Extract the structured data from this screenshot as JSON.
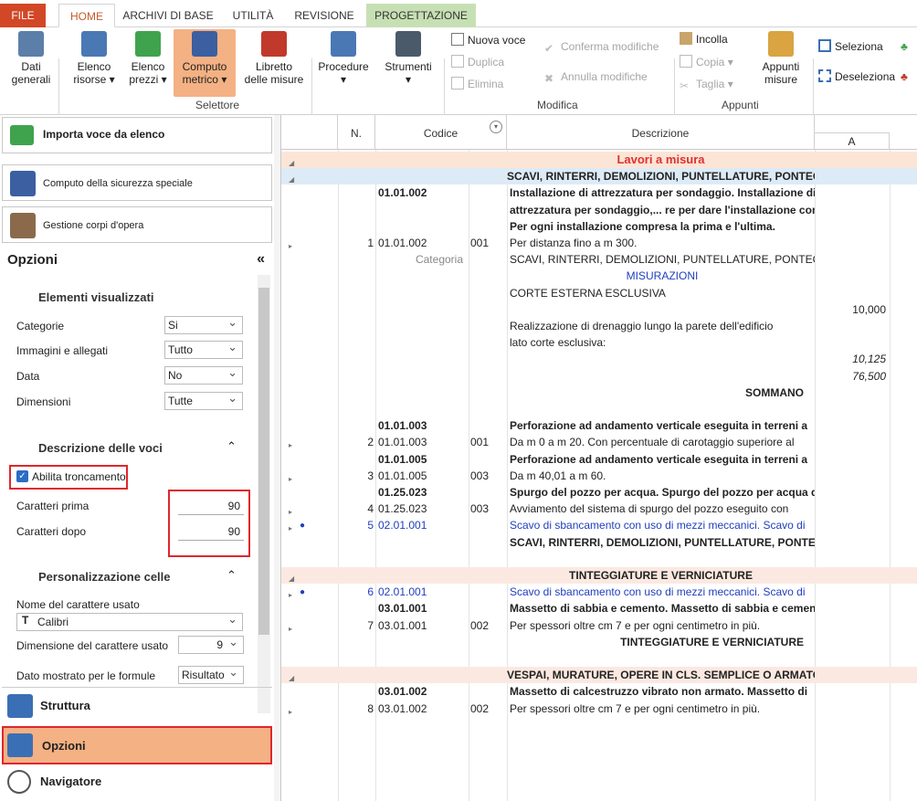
{
  "tabs": [
    "FILE",
    "HOME",
    "ARCHIVI DI BASE",
    "UTILITÀ",
    "REVISIONE",
    "PROGETTAZIONE"
  ],
  "ribbon": {
    "big": [
      {
        "label1": "Dati",
        "label2": "generali"
      },
      {
        "label1": "Elenco",
        "label2": "risorse ▾"
      },
      {
        "label1": "Elenco",
        "label2": "prezzi ▾"
      },
      {
        "label1": "Computo",
        "label2": "metrico ▾"
      },
      {
        "label1": "Libretto",
        "label2": "delle misure"
      },
      {
        "label1": "Procedure",
        "label2": "▾"
      },
      {
        "label1": "Strumenti",
        "label2": "▾"
      },
      {
        "label1": "Appunti",
        "label2": "misure"
      }
    ],
    "small": {
      "nuova": "Nuova voce",
      "duplica": "Duplica",
      "elimina": "Elimina",
      "conferma": "Conferma modifiche",
      "annulla": "Annulla modifiche",
      "incolla": "Incolla",
      "copia": "Copia",
      "taglia": "Taglia",
      "seleziona": "Seleziona",
      "deseleziona": "Deseleziona"
    },
    "groups": {
      "selettore": "Selettore",
      "modifica": "Modifica",
      "appunti": "Appunti"
    }
  },
  "left": {
    "importa": "Importa voce da elenco",
    "sicurezza": "Computo della sicurezza speciale",
    "corpi": "Gestione corpi d'opera",
    "opzioni_title": "Opzioni",
    "collapse": "«",
    "sec1": "Elementi visualizzati",
    "categorie_lbl": "Categorie",
    "categorie_val": "Si",
    "immagini_lbl": "Immagini e allegati",
    "immagini_val": "Tutto",
    "data_lbl": "Data",
    "data_val": "No",
    "dimensioni_lbl": "Dimensioni",
    "dimensioni_val": "Tutte",
    "sec2": "Descrizione delle voci",
    "abilita": "Abilita troncamento",
    "prima_lbl": "Caratteri prima",
    "prima_val": "90",
    "dopo_lbl": "Caratteri dopo",
    "dopo_val": "90",
    "sec3": "Personalizzazione celle",
    "font_lbl": "Nome del carattere usato",
    "font_val": "Calibri",
    "size_lbl": "Dimensione del carattere usato",
    "size_val": "9",
    "formule_lbl": "Dato mostrato per le formule",
    "formule_val": "Risultato",
    "nav": [
      "Struttura",
      "Opzioni",
      "Navigatore"
    ]
  },
  "grid": {
    "headers": {
      "n": "N.",
      "codice": "Codice",
      "descrizione": "Descrizione",
      "a": "A"
    },
    "rows": [
      {
        "type": "section",
        "desc": "Lavori a misura",
        "bg": "#fbe5d6",
        "color": "#e03030",
        "tri": true
      },
      {
        "type": "cat",
        "desc": "SCAVI, RINTERRI, DEMOLIZIONI, PUNTELLATURE, PONTEGGI",
        "bg": "#ddebf7",
        "tri": true
      },
      {
        "cod": "01.01.002",
        "desc": "Installazione di attrezzatura per sondaggio. Installazione di",
        "bold": true
      },
      {
        "desc": "attrezzatura per sondaggio,... re per dare l'installazione completa.",
        "bold": true
      },
      {
        "desc": "Per ogni installazione compresa la prima e l'ultima.",
        "bold": true
      },
      {
        "n": "1",
        "cod": "01.01.002",
        "sub": "001",
        "desc": "Per distanza fino a m 300.",
        "tri": true
      },
      {
        "cod": "Categoria",
        "desc": "SCAVI, RINTERRI, DEMOLIZIONI, PUNTELLATURE, PONTEGGI",
        "codgray": true
      },
      {
        "desc": "MISURAZIONI",
        "blue": true,
        "center": true
      },
      {
        "desc": "CORTE ESTERNA ESCLUSIVA"
      },
      {
        "a": "10,000"
      },
      {
        "desc": "Realizzazione di drenaggio lungo la parete dell'edificio"
      },
      {
        "desc": "lato corte esclusiva:"
      },
      {
        "a": "10,125",
        "italic": true
      },
      {
        "a": "76,500",
        "italic": true
      },
      {
        "desc": "SOMMANO",
        "bold": true,
        "right": true
      },
      {},
      {
        "cod": "01.01.003",
        "desc": "Perforazione ad andamento verticale eseguita in terreni a",
        "bold": true
      },
      {
        "n": "2",
        "cod": "01.01.003",
        "sub": "001",
        "desc": "Da m 0 a m 20. Con percentuale di carotaggio superiore al",
        "tri": true
      },
      {
        "cod": "01.01.005",
        "desc": "Perforazione ad andamento verticale eseguita in terreni a",
        "bold": true
      },
      {
        "n": "3",
        "cod": "01.01.005",
        "sub": "003",
        "desc": "Da m 40,01 a m 60.",
        "tri": true
      },
      {
        "cod": "01.25.023",
        "desc": "Spurgo del pozzo per acqua. Spurgo del pozzo per acqua da",
        "bold": true
      },
      {
        "n": "4",
        "cod": "01.25.023",
        "sub": "003",
        "desc": "Avviamento del sistema di spurgo del pozzo eseguito con",
        "tri": true
      },
      {
        "n": "5",
        "cod": "02.01.001",
        "desc": "Scavo di sbancamento con uso di mezzi meccanici. Scavo di",
        "tri": true,
        "dot": true,
        "linkrow": true
      },
      {
        "desc": "SCAVI, RINTERRI, DEMOLIZIONI, PUNTELLATURE, PONTEGGI",
        "bold": true,
        "right": true
      },
      {},
      {
        "type": "cat",
        "desc": "TINTEGGIATURE E VERNICIATURE",
        "bg": "#fbe9e1",
        "tri": true
      },
      {
        "n": "6",
        "cod": "02.01.001",
        "desc": "Scavo di sbancamento con uso di mezzi meccanici. Scavo di",
        "tri": true,
        "dot": true,
        "linkrow": true
      },
      {
        "cod": "03.01.001",
        "desc": "Massetto di sabbia e cemento. Massetto di sabbia e cemento",
        "bold": true
      },
      {
        "n": "7",
        "cod": "03.01.001",
        "sub": "002",
        "desc": "Per spessori oltre cm 7 e per ogni centimetro in più.",
        "tri": true
      },
      {
        "desc": "TINTEGGIATURE E VERNICIATURE",
        "bold": true,
        "right": true
      },
      {},
      {
        "type": "cat",
        "desc": "VESPAI, MURATURE, OPERE IN CLS. SEMPLICE O ARMATO",
        "bg": "#fbe9e1",
        "tri": true
      },
      {
        "cod": "03.01.002",
        "desc": "Massetto di calcestruzzo vibrato non armato. Massetto di",
        "bold": true
      },
      {
        "n": "8",
        "cod": "03.01.002",
        "sub": "002",
        "desc": "Per spessori oltre cm 7 e per ogni centimetro in più.",
        "tri": true
      }
    ]
  }
}
